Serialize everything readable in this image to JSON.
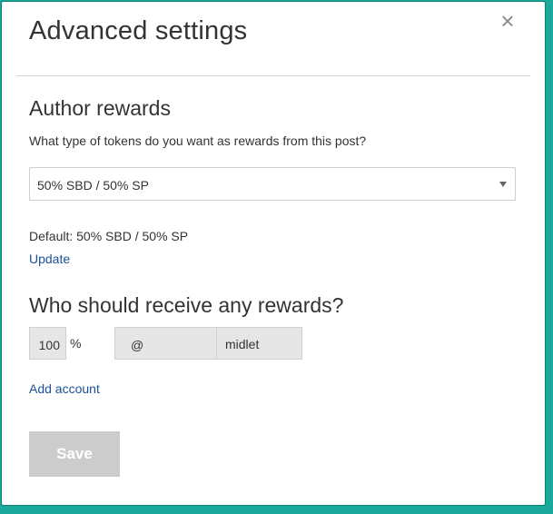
{
  "modal": {
    "title": "Advanced settings",
    "close_icon": "close-icon",
    "close_glyph": "×"
  },
  "author_rewards": {
    "heading": "Author rewards",
    "question": "What type of tokens do you want as rewards from this post?",
    "select_value": "50% SBD / 50% SP",
    "default_text": "Default: 50% SBD / 50% SP",
    "update_label": "Update"
  },
  "beneficiaries": {
    "heading": "Who should receive any rewards?",
    "percent_value": "100",
    "percent_sign": "%",
    "at_symbol": "@",
    "username_value": "midlet",
    "add_account_label": "Add account"
  },
  "actions": {
    "save_label": "Save"
  },
  "colors": {
    "backdrop": "#1aa99a",
    "link": "#1a5099",
    "button_disabled": "#cccccc",
    "input_disabled": "#e6e6e6"
  }
}
